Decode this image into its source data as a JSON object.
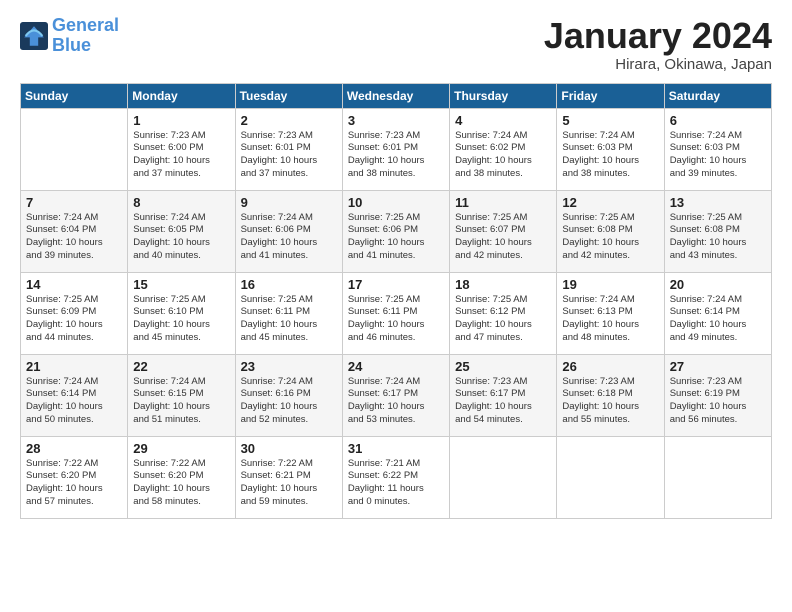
{
  "logo": {
    "line1": "General",
    "line2": "Blue"
  },
  "title": "January 2024",
  "subtitle": "Hirara, Okinawa, Japan",
  "columns": [
    "Sunday",
    "Monday",
    "Tuesday",
    "Wednesday",
    "Thursday",
    "Friday",
    "Saturday"
  ],
  "weeks": [
    [
      {
        "day": "",
        "info": ""
      },
      {
        "day": "1",
        "info": "Sunrise: 7:23 AM\nSunset: 6:00 PM\nDaylight: 10 hours\nand 37 minutes."
      },
      {
        "day": "2",
        "info": "Sunrise: 7:23 AM\nSunset: 6:01 PM\nDaylight: 10 hours\nand 37 minutes."
      },
      {
        "day": "3",
        "info": "Sunrise: 7:23 AM\nSunset: 6:01 PM\nDaylight: 10 hours\nand 38 minutes."
      },
      {
        "day": "4",
        "info": "Sunrise: 7:24 AM\nSunset: 6:02 PM\nDaylight: 10 hours\nand 38 minutes."
      },
      {
        "day": "5",
        "info": "Sunrise: 7:24 AM\nSunset: 6:03 PM\nDaylight: 10 hours\nand 38 minutes."
      },
      {
        "day": "6",
        "info": "Sunrise: 7:24 AM\nSunset: 6:03 PM\nDaylight: 10 hours\nand 39 minutes."
      }
    ],
    [
      {
        "day": "7",
        "info": "Sunrise: 7:24 AM\nSunset: 6:04 PM\nDaylight: 10 hours\nand 39 minutes."
      },
      {
        "day": "8",
        "info": "Sunrise: 7:24 AM\nSunset: 6:05 PM\nDaylight: 10 hours\nand 40 minutes."
      },
      {
        "day": "9",
        "info": "Sunrise: 7:24 AM\nSunset: 6:06 PM\nDaylight: 10 hours\nand 41 minutes."
      },
      {
        "day": "10",
        "info": "Sunrise: 7:25 AM\nSunset: 6:06 PM\nDaylight: 10 hours\nand 41 minutes."
      },
      {
        "day": "11",
        "info": "Sunrise: 7:25 AM\nSunset: 6:07 PM\nDaylight: 10 hours\nand 42 minutes."
      },
      {
        "day": "12",
        "info": "Sunrise: 7:25 AM\nSunset: 6:08 PM\nDaylight: 10 hours\nand 42 minutes."
      },
      {
        "day": "13",
        "info": "Sunrise: 7:25 AM\nSunset: 6:08 PM\nDaylight: 10 hours\nand 43 minutes."
      }
    ],
    [
      {
        "day": "14",
        "info": "Sunrise: 7:25 AM\nSunset: 6:09 PM\nDaylight: 10 hours\nand 44 minutes."
      },
      {
        "day": "15",
        "info": "Sunrise: 7:25 AM\nSunset: 6:10 PM\nDaylight: 10 hours\nand 45 minutes."
      },
      {
        "day": "16",
        "info": "Sunrise: 7:25 AM\nSunset: 6:11 PM\nDaylight: 10 hours\nand 45 minutes."
      },
      {
        "day": "17",
        "info": "Sunrise: 7:25 AM\nSunset: 6:11 PM\nDaylight: 10 hours\nand 46 minutes."
      },
      {
        "day": "18",
        "info": "Sunrise: 7:25 AM\nSunset: 6:12 PM\nDaylight: 10 hours\nand 47 minutes."
      },
      {
        "day": "19",
        "info": "Sunrise: 7:24 AM\nSunset: 6:13 PM\nDaylight: 10 hours\nand 48 minutes."
      },
      {
        "day": "20",
        "info": "Sunrise: 7:24 AM\nSunset: 6:14 PM\nDaylight: 10 hours\nand 49 minutes."
      }
    ],
    [
      {
        "day": "21",
        "info": "Sunrise: 7:24 AM\nSunset: 6:14 PM\nDaylight: 10 hours\nand 50 minutes."
      },
      {
        "day": "22",
        "info": "Sunrise: 7:24 AM\nSunset: 6:15 PM\nDaylight: 10 hours\nand 51 minutes."
      },
      {
        "day": "23",
        "info": "Sunrise: 7:24 AM\nSunset: 6:16 PM\nDaylight: 10 hours\nand 52 minutes."
      },
      {
        "day": "24",
        "info": "Sunrise: 7:24 AM\nSunset: 6:17 PM\nDaylight: 10 hours\nand 53 minutes."
      },
      {
        "day": "25",
        "info": "Sunrise: 7:23 AM\nSunset: 6:17 PM\nDaylight: 10 hours\nand 54 minutes."
      },
      {
        "day": "26",
        "info": "Sunrise: 7:23 AM\nSunset: 6:18 PM\nDaylight: 10 hours\nand 55 minutes."
      },
      {
        "day": "27",
        "info": "Sunrise: 7:23 AM\nSunset: 6:19 PM\nDaylight: 10 hours\nand 56 minutes."
      }
    ],
    [
      {
        "day": "28",
        "info": "Sunrise: 7:22 AM\nSunset: 6:20 PM\nDaylight: 10 hours\nand 57 minutes."
      },
      {
        "day": "29",
        "info": "Sunrise: 7:22 AM\nSunset: 6:20 PM\nDaylight: 10 hours\nand 58 minutes."
      },
      {
        "day": "30",
        "info": "Sunrise: 7:22 AM\nSunset: 6:21 PM\nDaylight: 10 hours\nand 59 minutes."
      },
      {
        "day": "31",
        "info": "Sunrise: 7:21 AM\nSunset: 6:22 PM\nDaylight: 11 hours\nand 0 minutes."
      },
      {
        "day": "",
        "info": ""
      },
      {
        "day": "",
        "info": ""
      },
      {
        "day": "",
        "info": ""
      }
    ]
  ]
}
